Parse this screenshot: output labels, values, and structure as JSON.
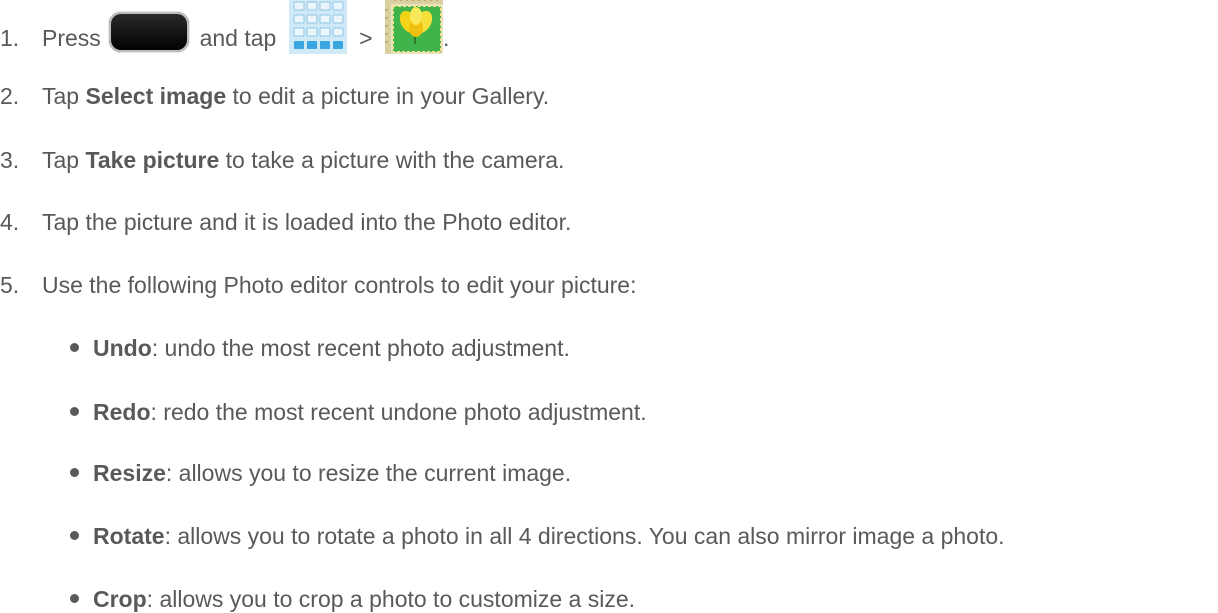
{
  "steps": [
    {
      "number": "1.",
      "text_before": "Press",
      "icon1": "home-key-icon",
      "text_middle": "and tap",
      "icon2": "apps-grid-icon",
      "separator": ">",
      "icon3": "photo-editor-icon",
      "text_after": "."
    },
    {
      "number": "2.",
      "prefix": "Tap ",
      "bold": "Select image",
      "suffix": " to edit a picture in your Gallery."
    },
    {
      "number": "3.",
      "prefix": "Tap ",
      "bold": "Take picture",
      "suffix": " to take a picture with the camera."
    },
    {
      "number": "4.",
      "text": "Tap the picture and it is loaded into the Photo editor."
    },
    {
      "number": "5.",
      "text": "Use the following Photo editor controls to edit your picture:"
    }
  ],
  "controls": [
    {
      "term": "Undo",
      "desc": ": undo the most recent photo adjustment."
    },
    {
      "term": "Redo",
      "desc": ": redo the most recent undone photo adjustment."
    },
    {
      "term": "Resize",
      "desc": ": allows you to resize the current image."
    },
    {
      "term": "Rotate",
      "desc": ": allows you to rotate a photo in all 4 directions. You can also mirror image a photo."
    },
    {
      "term": "Crop",
      "desc": ": allows you to crop a photo to customize a size."
    }
  ],
  "colors": {
    "text": "#595959"
  }
}
